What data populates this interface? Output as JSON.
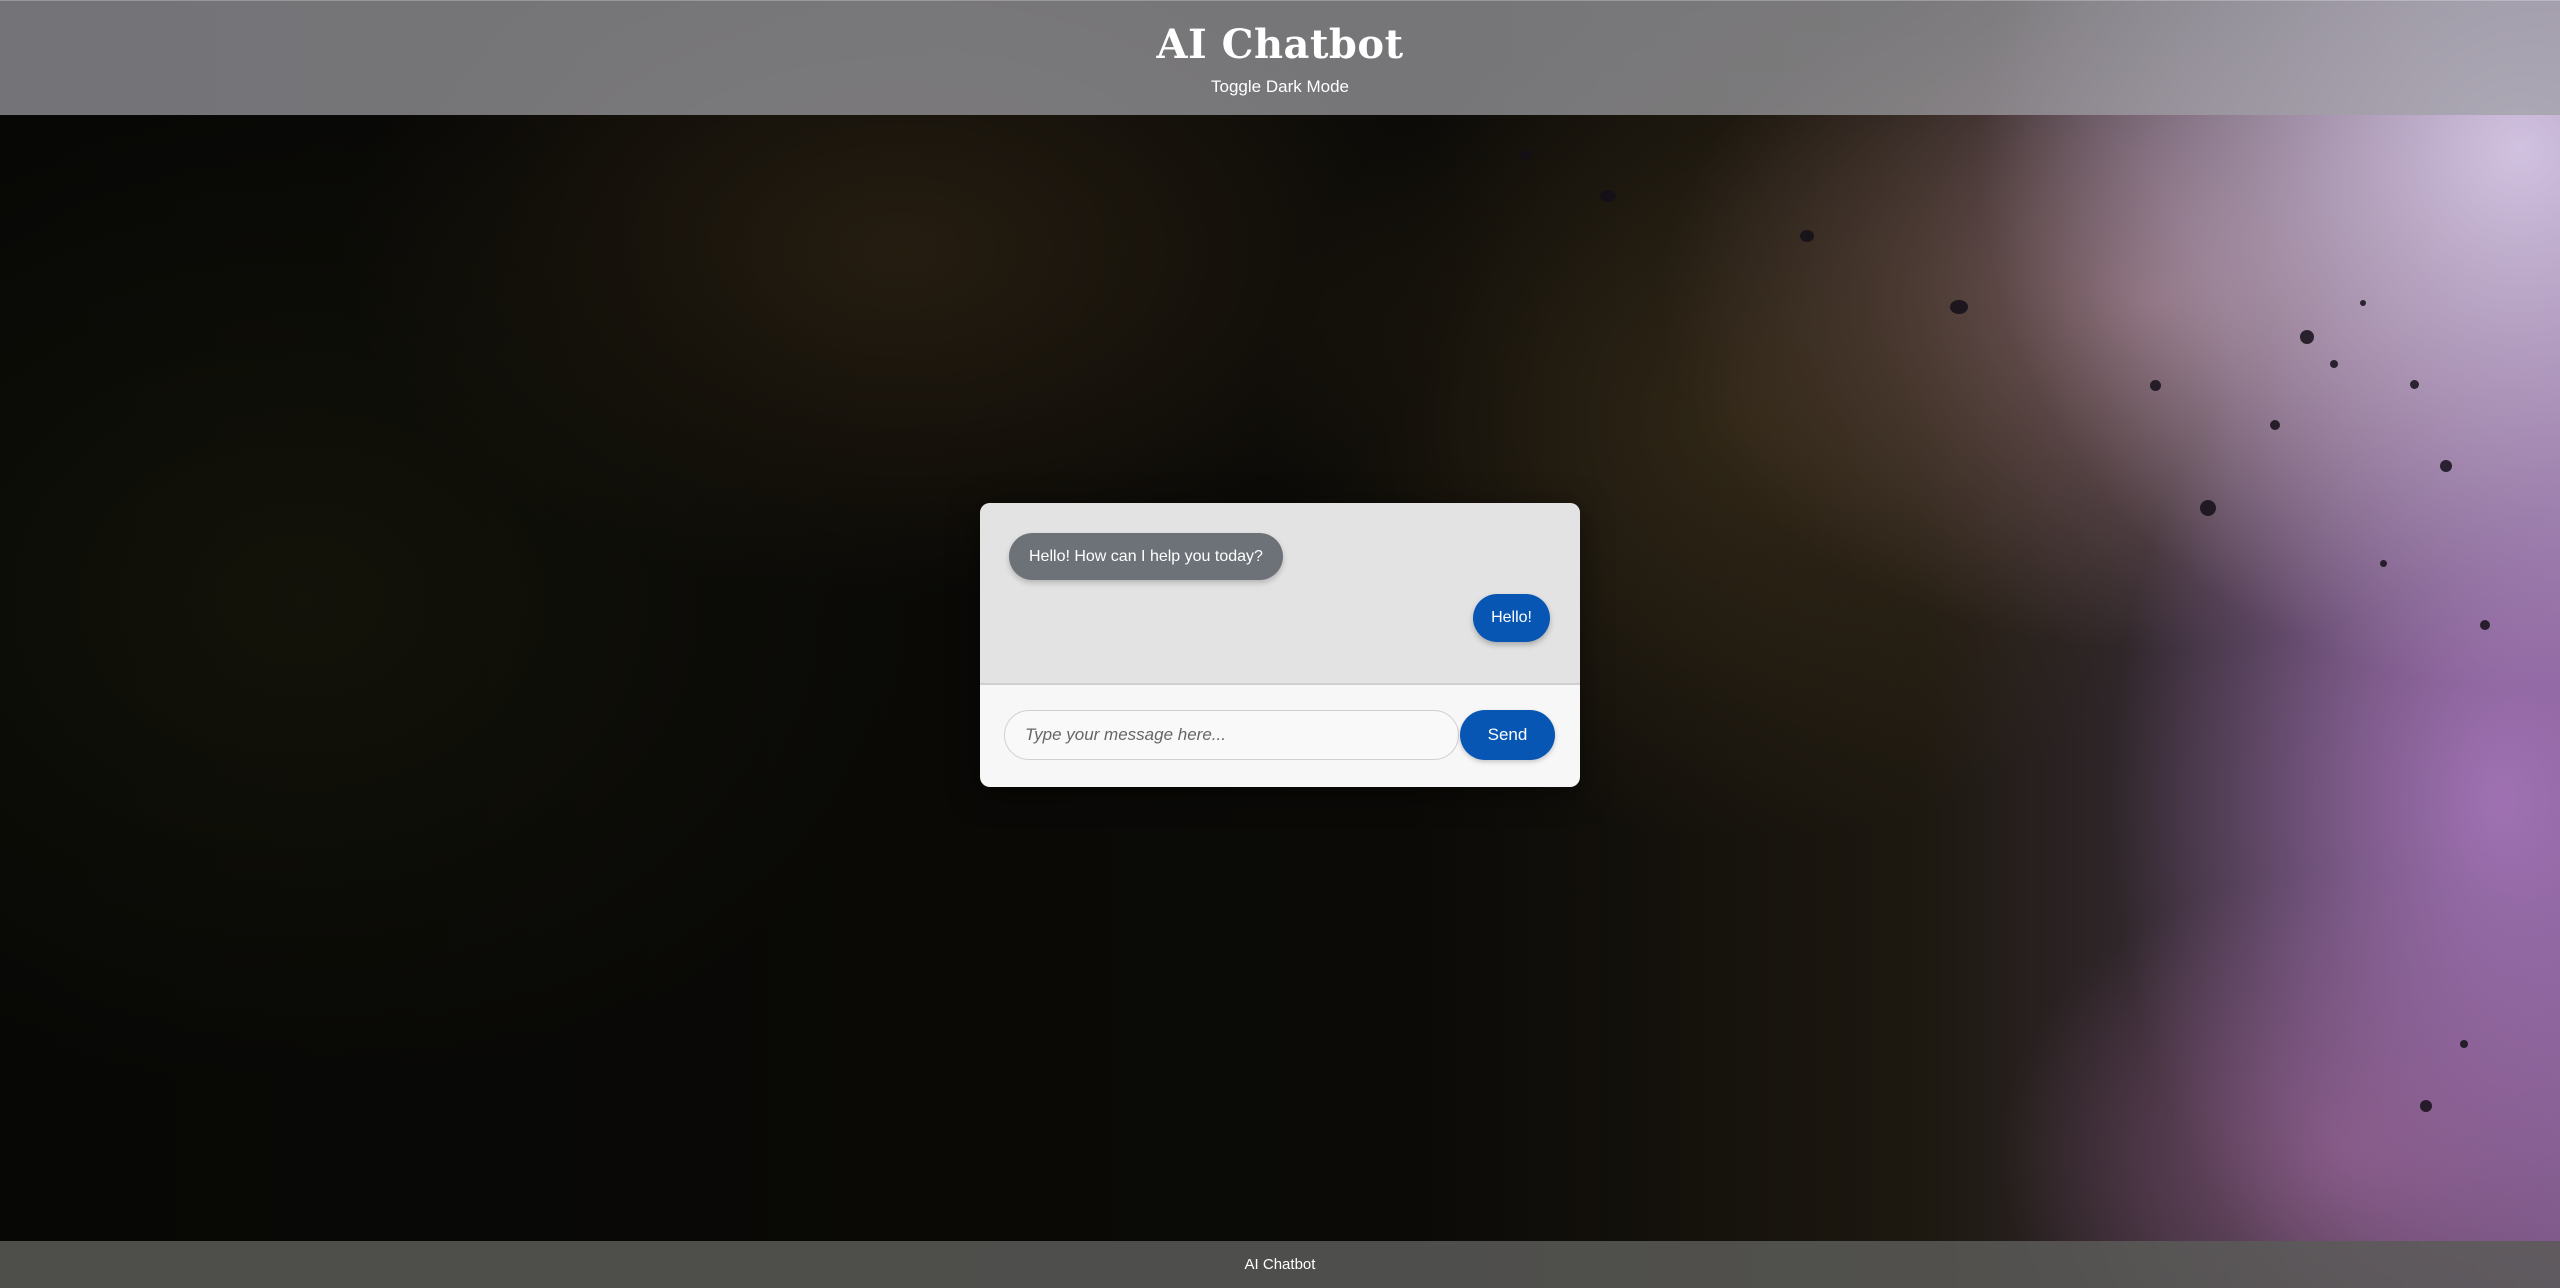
{
  "header": {
    "title": "AI Chatbot",
    "toggle_label": "Toggle Dark Mode"
  },
  "chat": {
    "messages": [
      {
        "sender": "bot",
        "text": "Hello! How can I help you today?"
      },
      {
        "sender": "user",
        "text": "Hello!"
      }
    ],
    "input": {
      "value": "",
      "placeholder": "Type your message here..."
    },
    "send_label": "Send"
  },
  "footer": {
    "text": "AI Chatbot"
  },
  "colors": {
    "accent": "#0756b3",
    "bot_bubble": "#6d7278",
    "header_overlay": "#a0a0a5",
    "footer_overlay": "#5a5a58"
  }
}
